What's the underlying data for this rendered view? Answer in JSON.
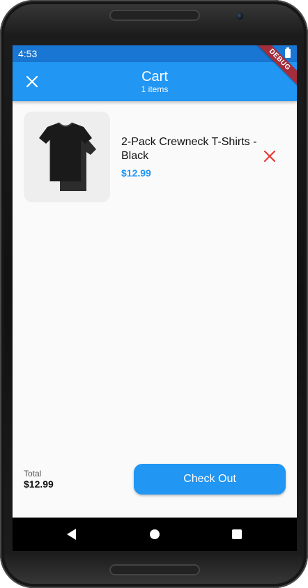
{
  "status_bar": {
    "time": "4:53"
  },
  "app_bar": {
    "title": "Cart",
    "subtitle": "1 items",
    "close_icon": "close-icon",
    "debug_label": "DEBUG"
  },
  "cart": {
    "items": [
      {
        "name": "2-Pack Crewneck T-Shirts - Black",
        "price": "$12.99",
        "image": "tshirt-image",
        "remove_icon": "remove-icon"
      }
    ]
  },
  "summary": {
    "total_label": "Total",
    "total_value": "$12.99",
    "checkout_label": "Check Out"
  },
  "nav": {
    "back_icon": "back-icon",
    "home_icon": "home-icon",
    "recents_icon": "recents-icon"
  },
  "colors": {
    "primary": "#2196f3",
    "status_bar": "#1976d2",
    "remove": "#e53935",
    "image_bg": "#eeeeee"
  }
}
